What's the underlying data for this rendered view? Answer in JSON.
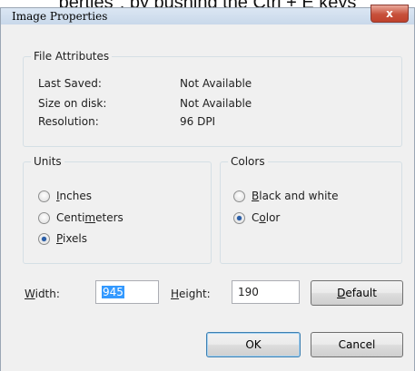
{
  "caption": "perties\", by pushing the Ctrl + E keys",
  "window": {
    "title": "Image Properties",
    "close_glyph": "x"
  },
  "file_attributes": {
    "legend": "File Attributes",
    "rows": [
      {
        "label": "Last Saved:",
        "value": "Not Available"
      },
      {
        "label": "Size on disk:",
        "value": "Not Available"
      },
      {
        "label": "Resolution:",
        "value": "96 DPI"
      }
    ]
  },
  "units": {
    "legend": "Units",
    "options": [
      {
        "label": "Inches",
        "selected": false
      },
      {
        "label": "Centimeters",
        "selected": false
      },
      {
        "label": "Pixels",
        "selected": true
      }
    ]
  },
  "colors": {
    "legend": "Colors",
    "options": [
      {
        "label": "Black and white",
        "selected": false
      },
      {
        "label": "Color",
        "selected": true
      }
    ]
  },
  "size": {
    "width_label": "Width:",
    "width_value": "945",
    "height_label": "Height:",
    "height_value": "190"
  },
  "buttons": {
    "default": "Default",
    "ok": "OK",
    "cancel": "Cancel"
  },
  "theme": {
    "selection": "#3399ff",
    "close_red": "#c7503a",
    "radio_dot": "#2a5ea8"
  }
}
